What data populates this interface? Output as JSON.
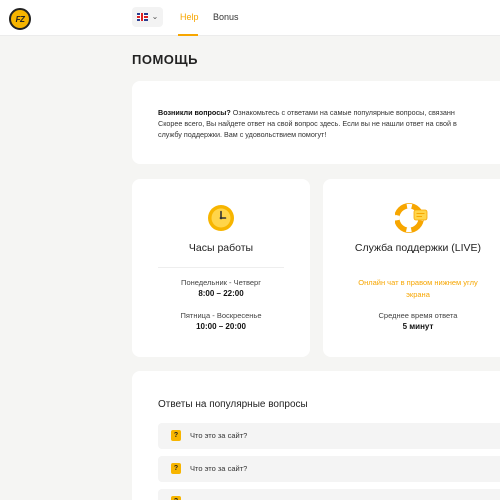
{
  "header": {
    "logo_text": "FZ",
    "language": "en-gb",
    "nav": [
      {
        "label": "Help",
        "active": true
      },
      {
        "label": "Bonus",
        "active": false
      }
    ],
    "accent_color": "#f7a600"
  },
  "page": {
    "title": "ПОМОЩЬ"
  },
  "intro": {
    "bold": "Возникли вопросы?",
    "line1": " Ознакомьтесь с ответами на самые популярные вопросы, связанн",
    "line2": "Скорее всего, Вы найдете ответ на свой вопрос здесь. Если вы не нашли ответ на свой в",
    "line3": "службу поддержки. Вам с удовольствием помогут!"
  },
  "hours_card": {
    "icon": "clock-icon",
    "title": "Часы работы",
    "weekdays_label": "Понедельник - Четверг",
    "weekdays_time": "8:00 – 22:00",
    "weekend_label": "Пятница - Воскресенье",
    "weekend_time": "10:00 – 20:00"
  },
  "support_card": {
    "icon": "lifebuoy-chat-icon",
    "title": "Служба поддержки (LIVE)",
    "link_line1": "Онлайн чат в правом нижнем углу",
    "link_line2": "экрана",
    "response_label": "Среднее время ответа",
    "response_value": "5 минут"
  },
  "faq": {
    "title": "Ответы на популярные вопросы",
    "items": [
      {
        "question": "Что это за сайт?"
      },
      {
        "question": "Что это за сайт?"
      }
    ]
  }
}
